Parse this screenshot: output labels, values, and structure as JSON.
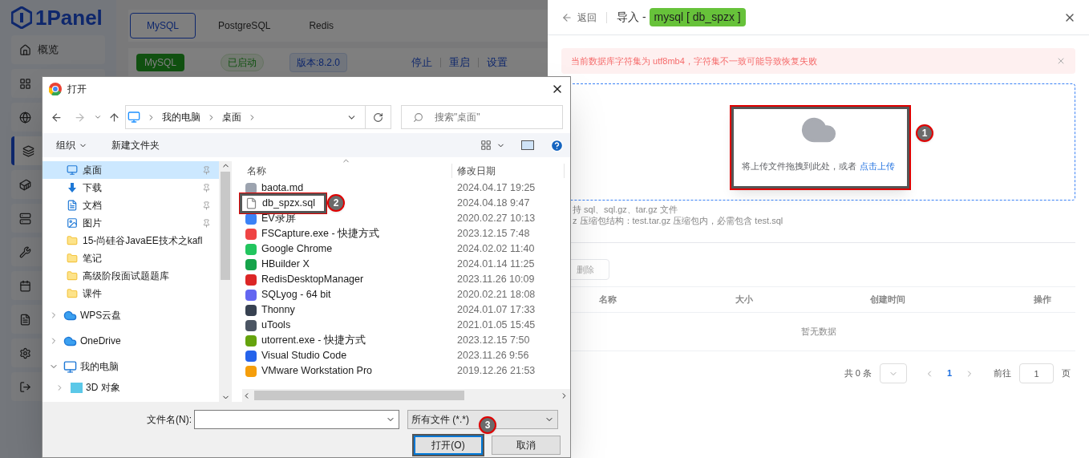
{
  "app": {
    "logo": "1Panel",
    "sidebar": [
      {
        "label": "概览",
        "selected": false
      },
      {
        "selected": false
      },
      {
        "selected": false
      },
      {
        "selected": true
      },
      {
        "selected": false
      },
      {
        "selected": false
      },
      {
        "selected": false
      },
      {
        "selected": false
      },
      {
        "selected": false
      },
      {
        "selected": false
      },
      {
        "selected": false
      }
    ],
    "tabs": [
      {
        "label": "MySQL",
        "selected": true
      },
      {
        "label": "PostgreSQL",
        "selected": false
      },
      {
        "label": "Redis",
        "selected": false
      }
    ],
    "service": {
      "tag": "MySQL",
      "status": "已启动",
      "version": "版本:8.2.0",
      "actions": [
        "停止",
        "重启",
        "设置"
      ]
    }
  },
  "drawer": {
    "back": "返回",
    "title": "导入 -",
    "db_tag": "mysql [ db_spzx ]",
    "alert": "当前数据库字符集为 utf8mb4，字符集不一致可能导致恢复失败",
    "upload_text": "将上传文件拖拽到此处，或者",
    "upload_link": "点击上传",
    "hints": [
      "持 sql、sql.gz、tar.gz 文件",
      "z 压缩包结构：test.tar.gz 压缩包内，必需包含 test.sql"
    ],
    "delete_button": "删除",
    "columns": [
      "名称",
      "大小",
      "创建时间",
      "操作"
    ],
    "empty": "暂无数据",
    "total": "共 0 条",
    "pages": [
      {
        "label": "1",
        "selected": true
      }
    ],
    "goto_label": "前往",
    "goto_value": "1",
    "page_suffix": "页"
  },
  "dialog": {
    "title": "打开",
    "breadcrumb": [
      "我的电脑",
      "桌面"
    ],
    "search_placeholder": "搜索\"桌面\"",
    "toolbar": [
      "组织",
      "新建文件夹"
    ],
    "nav": [
      {
        "kind": "quick",
        "label": "桌面",
        "pinned": true,
        "selected": true
      },
      {
        "kind": "quick",
        "label": "下载",
        "pinned": true,
        "selected": false
      },
      {
        "kind": "quick",
        "label": "文档",
        "pinned": true,
        "selected": false
      },
      {
        "kind": "quick",
        "label": "图片",
        "pinned": true,
        "selected": false
      },
      {
        "kind": "quick",
        "label": "15-尚硅谷JavaEE技术之kafl",
        "pinned": false,
        "selected": false
      },
      {
        "kind": "quick",
        "label": "笔记",
        "pinned": false,
        "selected": false
      },
      {
        "kind": "quick",
        "label": "高级阶段面试题题库",
        "pinned": false,
        "selected": false
      },
      {
        "kind": "quick",
        "label": "课件",
        "pinned": false,
        "selected": false
      },
      {
        "kind": "root",
        "label": "WPS云盘",
        "expanded": false,
        "selected": false
      },
      {
        "kind": "root",
        "label": "OneDrive",
        "expanded": false,
        "selected": false
      },
      {
        "kind": "root",
        "label": "我的电脑",
        "expanded": true,
        "selected": false
      },
      {
        "kind": "child",
        "label": "3D 对象",
        "selected": false
      }
    ],
    "columns": [
      "名称",
      "修改日期"
    ],
    "files": [
      {
        "name": "baota.md",
        "date": "2024.04.17 19:25"
      },
      {
        "name": "db_spzx.sql",
        "date": "2024.04.18 9:47"
      },
      {
        "name": "EV录屏",
        "date": "2020.02.27 10:13"
      },
      {
        "name": "FSCapture.exe - 快捷方式",
        "date": "2023.12.15 7:48"
      },
      {
        "name": "Google Chrome",
        "date": "2024.02.02 11:40"
      },
      {
        "name": "HBuilder X",
        "date": "2024.01.14 11:25"
      },
      {
        "name": "RedisDesktopManager",
        "date": "2023.11.26 10:09"
      },
      {
        "name": "SQLyog - 64 bit",
        "date": "2020.02.21 18:08"
      },
      {
        "name": "Thonny",
        "date": "2024.01.07 17:33"
      },
      {
        "name": "uTools",
        "date": "2021.01.05 15:45"
      },
      {
        "name": "utorrent.exe - 快捷方式",
        "date": "2023.12.15 7:50"
      },
      {
        "name": "Visual Studio Code",
        "date": "2023.11.26 9:56"
      },
      {
        "name": "VMware Workstation Pro",
        "date": "2019.12.26 21:53"
      }
    ],
    "filename_label": "文件名(N):",
    "filter": "所有文件 (*.*)",
    "open_button": "打开(O)",
    "cancel_button": "取消"
  },
  "annotations": [
    {
      "number": "1"
    },
    {
      "number": "2"
    },
    {
      "number": "3"
    }
  ]
}
